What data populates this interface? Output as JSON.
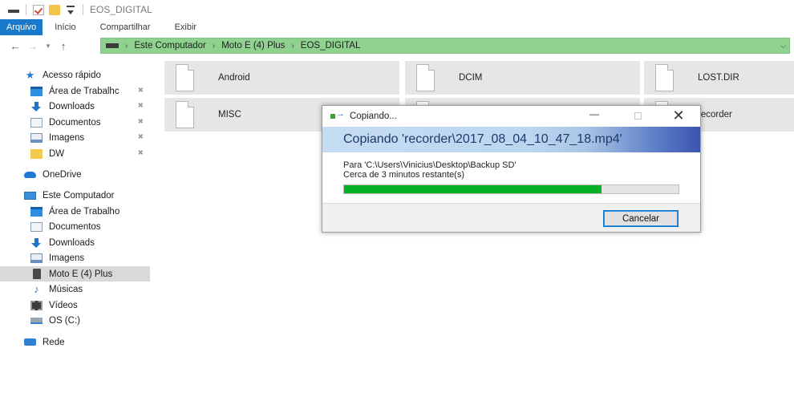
{
  "window": {
    "title": "EOS_DIGITAL"
  },
  "ribbon": {
    "tabs": [
      "Arquivo",
      "Início",
      "Compartilhar",
      "Exibir"
    ]
  },
  "address": {
    "crumbs": [
      "Este Computador",
      "Moto E (4) Plus",
      "EOS_DIGITAL"
    ]
  },
  "nav": {
    "quick_access": "Acesso rápido",
    "quick_items": [
      "Área de Trabalhc",
      "Downloads",
      "Documentos",
      "Imagens",
      "DW"
    ],
    "onedrive": "OneDrive",
    "this_pc": "Este Computador",
    "pc_items": [
      "Área de Trabalho",
      "Documentos",
      "Downloads",
      "Imagens",
      "Moto E (4) Plus",
      "Músicas",
      "Vídeos",
      "OS (C:)"
    ],
    "network": "Rede",
    "selected": "Moto E (4) Plus"
  },
  "files": [
    "Android",
    "DCIM",
    "LOST.DIR",
    "MISC",
    "recorder"
  ],
  "dialog": {
    "title": "Copiando...",
    "heading": "Copiando 'recorder\\2017_08_04_10_47_18.mp4'",
    "destination": "Para 'C:\\Users\\Vinicius\\Desktop\\Backup SD'",
    "remaining": "Cerca de 3 minutos restante(s)",
    "progress": 0.77,
    "cancel_label": "Cancelar"
  },
  "colors": {
    "accent": "#1979ca",
    "address_bg": "#8fd18f",
    "progress": "#06b025",
    "selected": "#d9d9d9"
  }
}
